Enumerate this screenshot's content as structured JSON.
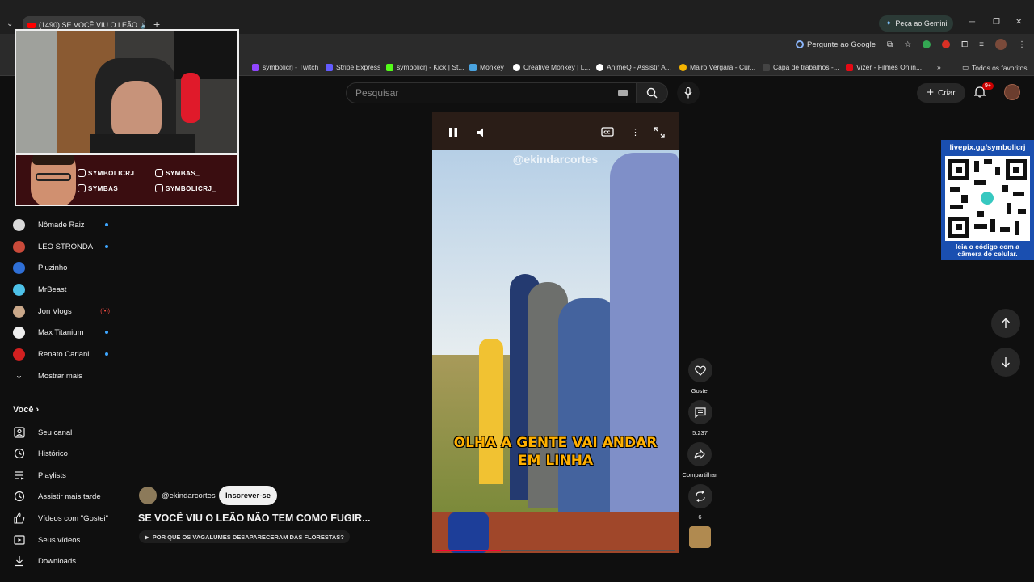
{
  "browser": {
    "tab_title": "(1490) SE VOCÊ VIU O LEÃO",
    "gemini_label": "Peça ao Gemini",
    "pergunte_label": "Pergunte ao Google",
    "bookmarks": [
      {
        "label": "symbolicrj - Twitch",
        "color": "#9146ff"
      },
      {
        "label": "Stripe Express",
        "color": "#635bff"
      },
      {
        "label": "symbolicrj - Kick | St...",
        "color": "#53fc18"
      },
      {
        "label": "Monkey",
        "color": "#4aa3df"
      },
      {
        "label": "Creative Monkey | L...",
        "color": "#ffffff"
      },
      {
        "label": "AnimeQ - Assistir A...",
        "color": "#ffffff"
      },
      {
        "label": "Mairo Vergara - Cur...",
        "color": "#f4b400"
      },
      {
        "label": "Capa de trabalhos -...",
        "color": "#444444"
      },
      {
        "label": "Vizer - Filmes Onlin...",
        "color": "#e50914"
      }
    ],
    "all_bookmarks": "Todos os favoritos"
  },
  "header": {
    "search_placeholder": "Pesquisar",
    "create_label": "Criar",
    "notif_badge": "9+"
  },
  "sidebar": {
    "subscriptions": [
      {
        "name": "Nômade Raiz",
        "color": "#d9d9d9",
        "status": "dot"
      },
      {
        "name": "LEO STRONDA",
        "color": "#c94a3a",
        "status": "dot"
      },
      {
        "name": "Piuzinho",
        "color": "#2f6fd6",
        "status": ""
      },
      {
        "name": "MrBeast",
        "color": "#4dc1e8",
        "status": ""
      },
      {
        "name": "Jon Vlogs",
        "color": "#caa88a",
        "status": "live"
      },
      {
        "name": "Max Titanium",
        "color": "#eeeeee",
        "status": "dot"
      },
      {
        "name": "Renato Cariani",
        "color": "#d22020",
        "status": "dot"
      }
    ],
    "show_more": "Mostrar mais",
    "voce": "Você",
    "nav": [
      {
        "label": "Seu canal",
        "icon": "channel-icon"
      },
      {
        "label": "Histórico",
        "icon": "history-icon"
      },
      {
        "label": "Playlists",
        "icon": "playlists-icon"
      },
      {
        "label": "Assistir mais tarde",
        "icon": "watch-later-icon"
      },
      {
        "label": "Vídeos com \"Gostei\"",
        "icon": "like-icon"
      },
      {
        "label": "Seus vídeos",
        "icon": "your-videos-icon"
      },
      {
        "label": "Downloads",
        "icon": "download-icon"
      }
    ]
  },
  "overlay": {
    "socials": [
      "SYMBOLICRJ",
      "SYMBAS_",
      "SYMBAS",
      "SYMBOLICRJ_"
    ]
  },
  "short": {
    "watermark": "@ekindarcortes",
    "caption_line1": "OLHA A GENTE VAI ANDAR",
    "caption_line2": "EM LINHA",
    "progress": 0.27
  },
  "actions": {
    "like_label": "Gostei",
    "comments_count": "5.237",
    "share_label": "Compartilhar",
    "remix_count": "6"
  },
  "video_info": {
    "channel": "@ekindarcortes",
    "subscribe_label": "Inscrever-se",
    "title": "SE VOCÊ VIU O LEÃO NÃO TEM COMO FUGIR...",
    "suggestion": "POR QUE OS VAGALUMES DESAPARECERAM DAS FLORESTAS?"
  },
  "qr": {
    "url": "livepix.gg/symbolicrj",
    "hint_line1": "leia o código com a",
    "hint_line2": "câmera do celular."
  }
}
